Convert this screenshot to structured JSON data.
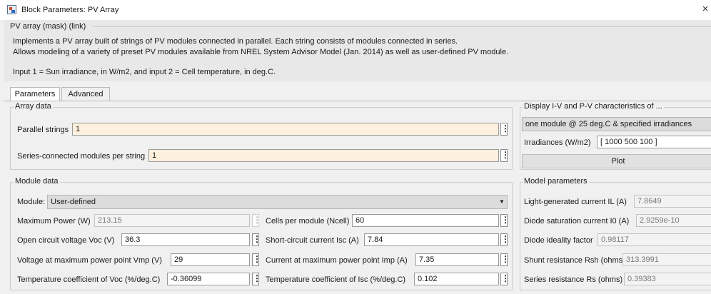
{
  "window": {
    "title": "Block Parameters: PV Array",
    "close_glyph": "×"
  },
  "mask": {
    "title": "PV array (mask) (link)",
    "description_lines": [
      "Implements a PV array built of strings of PV modules connected in parallel. Each string consists of modules connected in series.",
      "Allows modeling of a variety of preset PV modules available from NREL System Advisor Model (Jan. 2014) as well as user-defined PV module.",
      "Input 1 = Sun irradiance, in W/m2, and input 2 = Cell temperature, in deg.C."
    ]
  },
  "tabs": [
    {
      "label": "Parameters",
      "active": true
    },
    {
      "label": "Advanced",
      "active": false
    }
  ],
  "array_data": {
    "title": "Array data",
    "parallel_strings": {
      "label": "Parallel strings",
      "value": "1"
    },
    "series_modules": {
      "label": "Series-connected modules per string",
      "value": "1"
    }
  },
  "display": {
    "title": "Display  I-V and P-V characteristics of ...",
    "selection": "one module @ 25 deg.C & specified irradiances",
    "irradiances_label": "Irradiances (W/m2)",
    "irradiances_value": "[ 1000  500  100 ]",
    "plot_label": "Plot"
  },
  "module_data": {
    "title": "Module data",
    "module_label": "Module:",
    "module_value": "User-defined",
    "max_power": {
      "label": "Maximum Power (W)",
      "value": "213.15"
    },
    "cells": {
      "label": "Cells per module (Ncell)",
      "value": "60"
    },
    "voc": {
      "label": "Open circuit voltage  Voc (V)",
      "value": "36.3"
    },
    "isc": {
      "label": "Short-circuit current Isc (A)",
      "value": "7.84"
    },
    "vmp": {
      "label": "Voltage at maximum power point Vmp (V)",
      "value": "29"
    },
    "imp": {
      "label": "Current at maximum power point Imp (A)",
      "value": "7.35"
    },
    "tc_voc": {
      "label": "Temperature coefficient of Voc (%/deg.C)",
      "value": "-0.36099"
    },
    "tc_isc": {
      "label": "Temperature coefficient of Isc (%/deg.C)",
      "value": "0.102"
    }
  },
  "model_params": {
    "title": "Model parameters",
    "il": {
      "label": "Light-generated current IL (A)",
      "value": "7.8649"
    },
    "i0": {
      "label": "Diode saturation current I0 (A)",
      "value": "2.9259e-10"
    },
    "ideality": {
      "label": "Diode ideality factor",
      "value": "0.98117"
    },
    "rsh": {
      "label": "Shunt resistance Rsh (ohms)",
      "value": "313.3991"
    },
    "rs": {
      "label": "Series resistance Rs (ohms)",
      "value": "0.39383"
    }
  },
  "colors": {
    "editable_field": "#fdf0dc",
    "dialog_background": "#f0f0f0",
    "readonly_text": "#7a7a7a"
  },
  "icons": {
    "app": "simulink-block-icon",
    "close": "close-icon",
    "dots": "more-options-icon",
    "caret": "chevron-down-icon"
  }
}
